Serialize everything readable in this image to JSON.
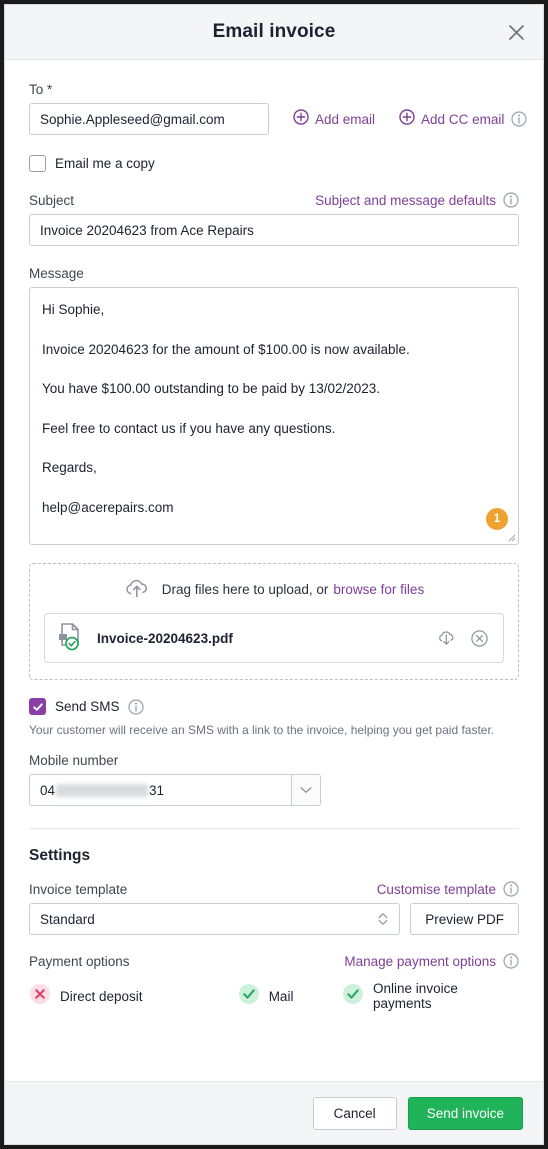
{
  "header": {
    "title": "Email invoice",
    "close_label": "×"
  },
  "to": {
    "label": "To *",
    "value": "Sophie.Appleseed@gmail.com",
    "add_email_label": "Add email",
    "add_cc_email_label": "Add CC email"
  },
  "email_copy": {
    "label": "Email me a copy",
    "checked": false
  },
  "subject": {
    "label": "Subject",
    "defaults_link": "Subject and message defaults",
    "value": "Invoice 20204623 from Ace Repairs"
  },
  "message": {
    "label": "Message",
    "lines": [
      "Hi Sophie,",
      "Invoice 20204623 for the amount of $100.00 is now available.",
      "You have $100.00 outstanding to be paid by 13/02/2023.",
      "Feel free to contact us if you have any questions.",
      "Regards,",
      "help@acerepairs.com"
    ],
    "badge_count": "1"
  },
  "dropzone": {
    "prompt": "Drag files here to upload, or",
    "browse_link": "browse for files",
    "file": {
      "name": "Invoice-20204623.pdf",
      "download_title": "Download",
      "remove_title": "Remove"
    }
  },
  "send_sms": {
    "label": "Send SMS",
    "checked": true,
    "helper": "Your customer will receive an SMS with a link to the invoice, helping you get paid faster.",
    "mobile_label": "Mobile number",
    "mobile_prefix": "04",
    "mobile_suffix": "31"
  },
  "settings": {
    "title": "Settings",
    "invoice_template_label": "Invoice template",
    "customise_link": "Customise template",
    "template_value": "Standard",
    "template_options": [
      "Standard"
    ],
    "preview_label": "Preview PDF",
    "payment_options_label": "Payment options",
    "manage_payments_link": "Manage payment options",
    "payment_options": [
      {
        "label": "Direct deposit",
        "state": "off"
      },
      {
        "label": "Mail",
        "state": "on"
      },
      {
        "label": "Online invoice payments",
        "state": "on"
      }
    ]
  },
  "footer": {
    "cancel_label": "Cancel",
    "send_label": "Send invoice"
  },
  "colors": {
    "accent_purple": "#7e3f98",
    "checkbox_purple": "#8a3fa8",
    "primary_green": "#21b35a",
    "badge_orange": "#efa230",
    "success_green": "#2aa861",
    "error_pink": "#d9436f"
  }
}
